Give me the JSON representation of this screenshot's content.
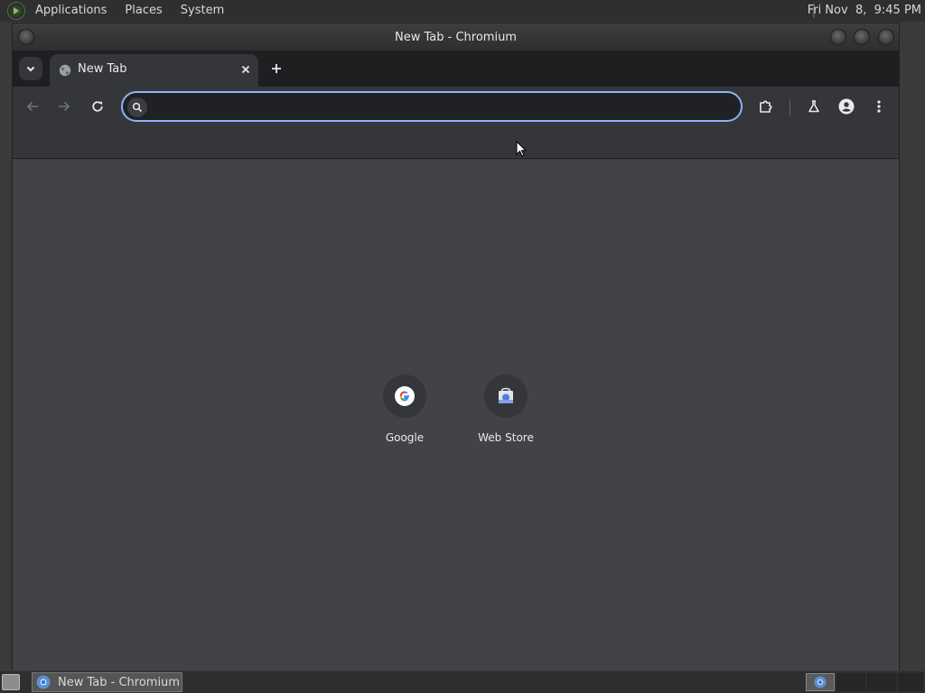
{
  "top_panel": {
    "menus": [
      "Applications",
      "Places",
      "System"
    ],
    "clock": "Fri Nov  8,  9:45 PM"
  },
  "window": {
    "title": "New Tab - Chromium"
  },
  "tabstrip": {
    "tabs": [
      {
        "title": "New Tab",
        "favicon": "globe-icon",
        "active": true
      }
    ]
  },
  "toolbar": {
    "omnibox_value": "",
    "omnibox_placeholder": ""
  },
  "shortcuts": [
    {
      "label": "Google",
      "icon": "google-icon"
    },
    {
      "label": "Web Store",
      "icon": "web-store-icon"
    }
  ],
  "taskbar": {
    "items": [
      {
        "label": "New Tab - Chromium",
        "icon": "chromium-icon"
      }
    ]
  },
  "colors": {
    "accent": "#8ab4f8",
    "content_bg": "#434247",
    "toolbar_bg": "#35363a",
    "tabstrip_bg": "#1f1f22"
  }
}
